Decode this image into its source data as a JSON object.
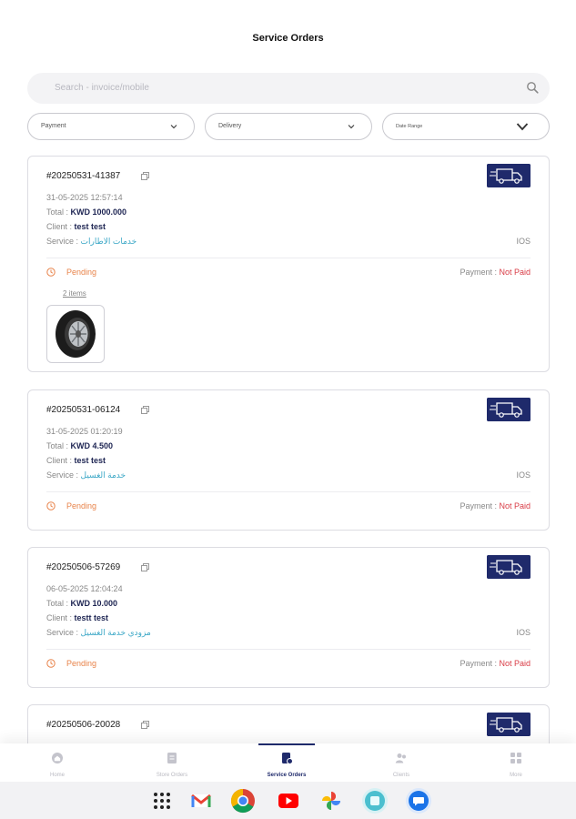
{
  "header": {
    "title": "Service Orders"
  },
  "search": {
    "placeholder": "Search - invoice/mobile"
  },
  "filters": {
    "payment": "Payment",
    "delivery": "Delivery",
    "date_range": "Date Range"
  },
  "labels": {
    "total": "Total : ",
    "client": "Client : ",
    "service": "Service : ",
    "payment": "Payment : "
  },
  "orders": [
    {
      "number": "#20250531-41387",
      "datetime": "31-05-2025 12:57:14",
      "total": "KWD 1000.000",
      "client": "test test",
      "service": "خدمات الاطارات",
      "platform": "IOS",
      "status": "Pending",
      "payment_status": "Not Paid",
      "items": "2 items"
    },
    {
      "number": "#20250531-06124",
      "datetime": "31-05-2025 01:20:19",
      "total": "KWD 4.500",
      "client": "test test",
      "service": "خدمة الغسيل",
      "platform": "IOS",
      "status": "Pending",
      "payment_status": "Not Paid"
    },
    {
      "number": "#20250506-57269",
      "datetime": "06-05-2025 12:04:24",
      "total": "KWD 10.000",
      "client": "testt test",
      "service": "مزودي خدمة الغسيل",
      "platform": "IOS",
      "status": "Pending",
      "payment_status": "Not Paid"
    },
    {
      "number": "#20250506-20028"
    }
  ],
  "nav": {
    "home": "Home",
    "store_orders": "Store Orders",
    "service_orders": "Service Orders",
    "clients": "Clients",
    "more": "More"
  },
  "colors": {
    "primary": "#1f2a6b",
    "pending": "#e8834a",
    "not_paid": "#d93b45",
    "service": "#3aa7c6"
  }
}
